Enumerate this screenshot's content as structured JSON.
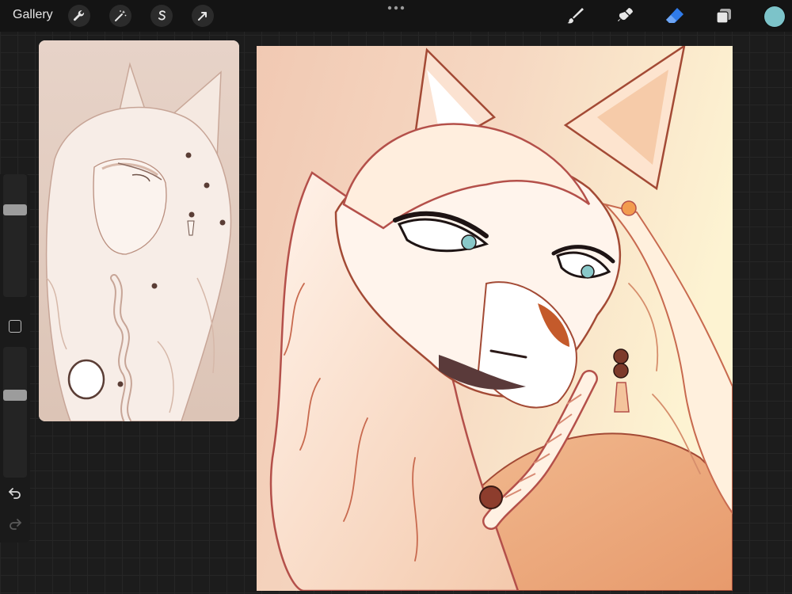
{
  "app": {
    "gallery_label": "Gallery"
  },
  "toolbar": {
    "left_tools": [
      {
        "name": "actions",
        "icon": "wrench-icon"
      },
      {
        "name": "adjustments",
        "icon": "magic-wand-icon"
      },
      {
        "name": "selection",
        "icon": "selection-s-icon"
      },
      {
        "name": "transform",
        "icon": "arrow-cursor-icon"
      }
    ],
    "more_icon": "more-dots-icon",
    "right_tools": [
      {
        "name": "brush",
        "icon": "brush-icon"
      },
      {
        "name": "smudge",
        "icon": "smudge-icon"
      },
      {
        "name": "eraser",
        "icon": "eraser-icon",
        "active": true
      },
      {
        "name": "layers",
        "icon": "layers-icon"
      }
    ],
    "active_color": "#7cc3c9",
    "active_tool_color": "#2f7bea"
  },
  "sidebar": {
    "brush_size_level": 0.27,
    "opacity_level": 0.36,
    "modify_icon": "square-icon",
    "undo_icon": "undo-icon",
    "redo_icon": "redo-icon"
  },
  "reference_window": {
    "kind": "sketch-image"
  },
  "canvas": {
    "kind": "illustration"
  }
}
